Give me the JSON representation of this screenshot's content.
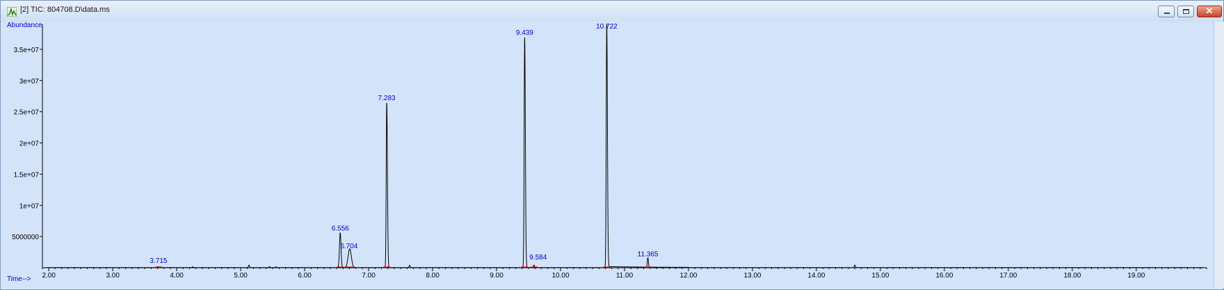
{
  "window": {
    "title": "[2] TIC: 804708.D\\data.ms",
    "icon": "chromatogram-icon",
    "controls": {
      "minimize": "minimize-icon",
      "maximize": "maximize-icon",
      "close": "close-icon",
      "close_glyph": "✕"
    }
  },
  "colors": {
    "trace": "#000000",
    "axis": "#000000",
    "label": "#0000cc",
    "background": "#d3e3fa",
    "baseline": "#ff0000"
  },
  "chart_data": {
    "type": "line",
    "title": "",
    "ylabel": "Abundance",
    "xlabel": "Time-->",
    "xlim": [
      1.9,
      20.1
    ],
    "ylim": [
      0,
      39000000
    ],
    "x_ticks": [
      2,
      3,
      4,
      5,
      6,
      7,
      8,
      9,
      10,
      11,
      12,
      13,
      14,
      15,
      16,
      17,
      18,
      19
    ],
    "x_tick_labels": [
      "2.00",
      "3.00",
      "4.00",
      "5.00",
      "6.00",
      "7.00",
      "8.00",
      "9.00",
      "10.00",
      "11.00",
      "12.00",
      "13.00",
      "14.00",
      "15.00",
      "16.00",
      "17.00",
      "18.00",
      "19.00"
    ],
    "y_ticks": [
      5000000,
      10000000,
      15000000,
      20000000,
      25000000,
      30000000,
      35000000
    ],
    "y_tick_labels": [
      "5000000",
      "1e+07",
      "1.5e+07",
      "2e+07",
      "2.5e+07",
      "3e+07",
      "3.5e+07"
    ],
    "grid": false,
    "peaks": [
      {
        "rt": 3.715,
        "label": "3.715",
        "height": 150000
      },
      {
        "rt": 6.556,
        "label": "6.556",
        "height": 5600000
      },
      {
        "rt": 6.704,
        "label": "6.704",
        "height": 3000000
      },
      {
        "rt": 7.283,
        "label": "7.283",
        "height": 26500000
      },
      {
        "rt": 9.439,
        "label": "9.439",
        "height": 37000000
      },
      {
        "rt": 9.584,
        "label": "9.584",
        "height": 400000
      },
      {
        "rt": 10.722,
        "label": "10.722",
        "height": 39000000
      },
      {
        "rt": 11.365,
        "label": "11.365",
        "height": 1500000
      }
    ],
    "minor_peaks": [
      {
        "rt": 4.25,
        "height": 120000
      },
      {
        "rt": 5.13,
        "height": 400000
      },
      {
        "rt": 5.45,
        "height": 150000
      },
      {
        "rt": 5.55,
        "height": 120000
      },
      {
        "rt": 7.64,
        "height": 350000
      },
      {
        "rt": 14.6,
        "height": 400000
      }
    ]
  }
}
